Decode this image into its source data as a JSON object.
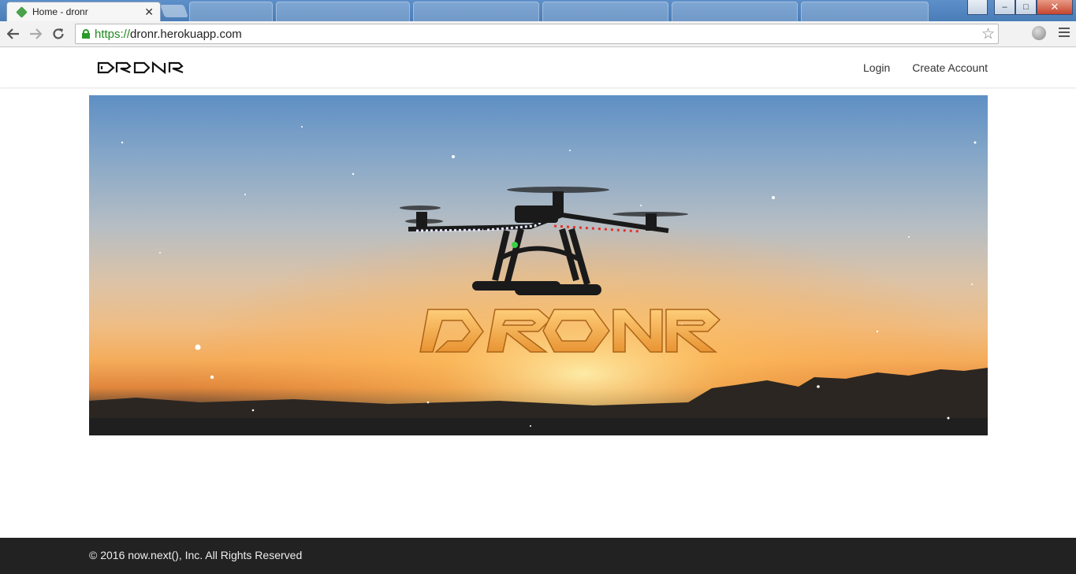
{
  "browser": {
    "active_tab": {
      "title": "Home - dronr",
      "close_glyph": "✕"
    },
    "url": {
      "scheme": "https://",
      "host": "dronr.herokuapp.com"
    },
    "window_buttons": {
      "minimize": "–",
      "maximize": "□",
      "close": "✕"
    }
  },
  "site": {
    "nav": {
      "login": "Login",
      "create_account": "Create Account"
    },
    "footer": {
      "copyright": "© 2016 now.next(), Inc. All Rights Reserved"
    }
  },
  "icons": {
    "back": "back-arrow-icon",
    "forward": "forward-arrow-icon",
    "reload": "reload-icon",
    "lock": "lock-icon",
    "bookmark": "star-icon",
    "menu": "hamburger-menu-icon"
  },
  "colors": {
    "footer_bg": "#222222",
    "secure_green": "#1e8a1e",
    "titlebar_blue": "#4a7db8"
  }
}
